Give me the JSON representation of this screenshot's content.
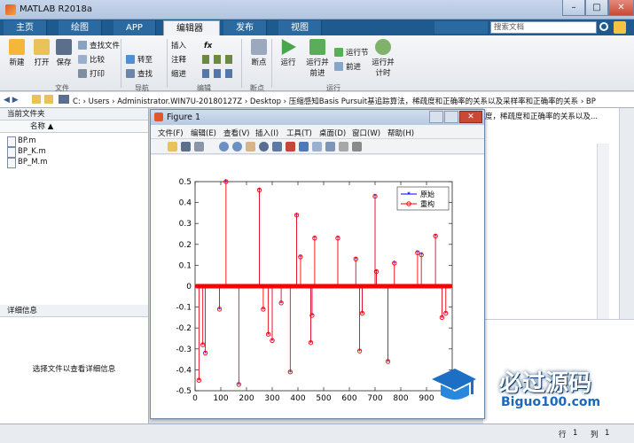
{
  "window": {
    "title": "MATLAB R2018a",
    "min": "–",
    "max": "□",
    "close": "✕"
  },
  "tabs": [
    "主页",
    "绘图",
    "APP",
    "编辑器",
    "发布",
    "视图"
  ],
  "active_tab": "编辑器",
  "search": {
    "placeholder": "搜索文档"
  },
  "toolstrip": {
    "file": {
      "new": "新建",
      "open": "打开",
      "save": "保存",
      "find_files": "查找文件",
      "compare": "比较",
      "print": "打印",
      "group": "文件"
    },
    "nav": {
      "goto": "转至",
      "find": "查找",
      "group": "导航"
    },
    "edit": {
      "insert": "插入",
      "comment": "注释",
      "indent": "缩进",
      "fx": "fx",
      "group": "编辑"
    },
    "breakpoints": {
      "label": "断点",
      "group": "断点"
    },
    "run": {
      "run": "运行",
      "run_advance_1": "运行并",
      "run_advance_2": "前进",
      "run_section": "运行节",
      "advance": "前进",
      "run_time_1": "运行并",
      "run_time_2": "计时",
      "group": "运行"
    }
  },
  "address": {
    "path": "C: › Users › Administrator.WIN7U-20180127Z › Desktop › 压缩感知Basis Pursuit基追踪算法，稀疏度和正确率的关系以及采样率和正确率的关系 › BP"
  },
  "current_folder": {
    "title": "当前文件夹",
    "column": "名称 ▲",
    "files": [
      "BP.m",
      "BP_K.m",
      "BP_M.m"
    ]
  },
  "details": {
    "title": "详细信息",
    "hint": "选择文件以查看详细信息"
  },
  "right_panel": {
    "text": "度，稀疏度和正确率的关系以及..."
  },
  "status": {
    "line_label": "行",
    "line": "1",
    "col_label": "列",
    "col": "1"
  },
  "figure": {
    "title": "Figure 1",
    "menu": [
      "文件(F)",
      "编辑(E)",
      "查看(V)",
      "插入(I)",
      "工具(T)",
      "桌面(D)",
      "窗口(W)",
      "帮助(H)"
    ]
  },
  "watermark": {
    "brand": "必过源码",
    "url": "Biguo100.com"
  },
  "chart_data": {
    "type": "stem",
    "title": "",
    "xlabel": "",
    "ylabel": "",
    "xlim": [
      0,
      1000
    ],
    "ylim": [
      -0.5,
      0.5
    ],
    "xticks": [
      0,
      100,
      200,
      300,
      400,
      500,
      600,
      700,
      800,
      900
    ],
    "yticks": [
      -0.5,
      -0.4,
      -0.3,
      -0.2,
      -0.1,
      0,
      0.1,
      0.2,
      0.3,
      0.4,
      0.5
    ],
    "legend": {
      "position": "top-right",
      "entries": [
        "原始",
        "重构"
      ]
    },
    "colors": {
      "original": "#0000ff",
      "reconstructed": "#ff0000"
    },
    "series": [
      {
        "name": "原始",
        "points": [
          [
            15,
            -0.45
          ],
          [
            30,
            -0.28
          ],
          [
            40,
            -0.32
          ],
          [
            95,
            -0.11
          ],
          [
            120,
            0.5
          ],
          [
            170,
            -0.47
          ],
          [
            250,
            0.46
          ],
          [
            265,
            -0.11
          ],
          [
            285,
            -0.23
          ],
          [
            300,
            -0.26
          ],
          [
            335,
            -0.08
          ],
          [
            370,
            -0.41
          ],
          [
            395,
            0.34
          ],
          [
            410,
            0.14
          ],
          [
            450,
            -0.27
          ],
          [
            455,
            -0.14
          ],
          [
            465,
            0.23
          ],
          [
            555,
            0.23
          ],
          [
            625,
            0.13
          ],
          [
            640,
            -0.31
          ],
          [
            650,
            -0.13
          ],
          [
            700,
            0.43
          ],
          [
            705,
            0.07
          ],
          [
            750,
            -0.36
          ],
          [
            775,
            0.11
          ],
          [
            865,
            0.16
          ],
          [
            880,
            0.15
          ],
          [
            935,
            0.24
          ],
          [
            960,
            -0.15
          ],
          [
            975,
            -0.13
          ]
        ]
      },
      {
        "name": "重构",
        "points": [
          [
            15,
            -0.45
          ],
          [
            30,
            -0.28
          ],
          [
            40,
            -0.32
          ],
          [
            95,
            -0.11
          ],
          [
            120,
            0.5
          ],
          [
            170,
            -0.47
          ],
          [
            250,
            0.46
          ],
          [
            265,
            -0.11
          ],
          [
            285,
            -0.23
          ],
          [
            300,
            -0.26
          ],
          [
            335,
            -0.08
          ],
          [
            370,
            -0.41
          ],
          [
            395,
            0.34
          ],
          [
            410,
            0.14
          ],
          [
            450,
            -0.27
          ],
          [
            455,
            -0.14
          ],
          [
            465,
            0.23
          ],
          [
            555,
            0.23
          ],
          [
            625,
            0.13
          ],
          [
            640,
            -0.31
          ],
          [
            650,
            -0.13
          ],
          [
            700,
            0.43
          ],
          [
            705,
            0.07
          ],
          [
            750,
            -0.36
          ],
          [
            775,
            0.11
          ],
          [
            865,
            0.16
          ],
          [
            880,
            0.15
          ],
          [
            935,
            0.24
          ],
          [
            960,
            -0.15
          ],
          [
            975,
            -0.13
          ]
        ]
      }
    ]
  }
}
